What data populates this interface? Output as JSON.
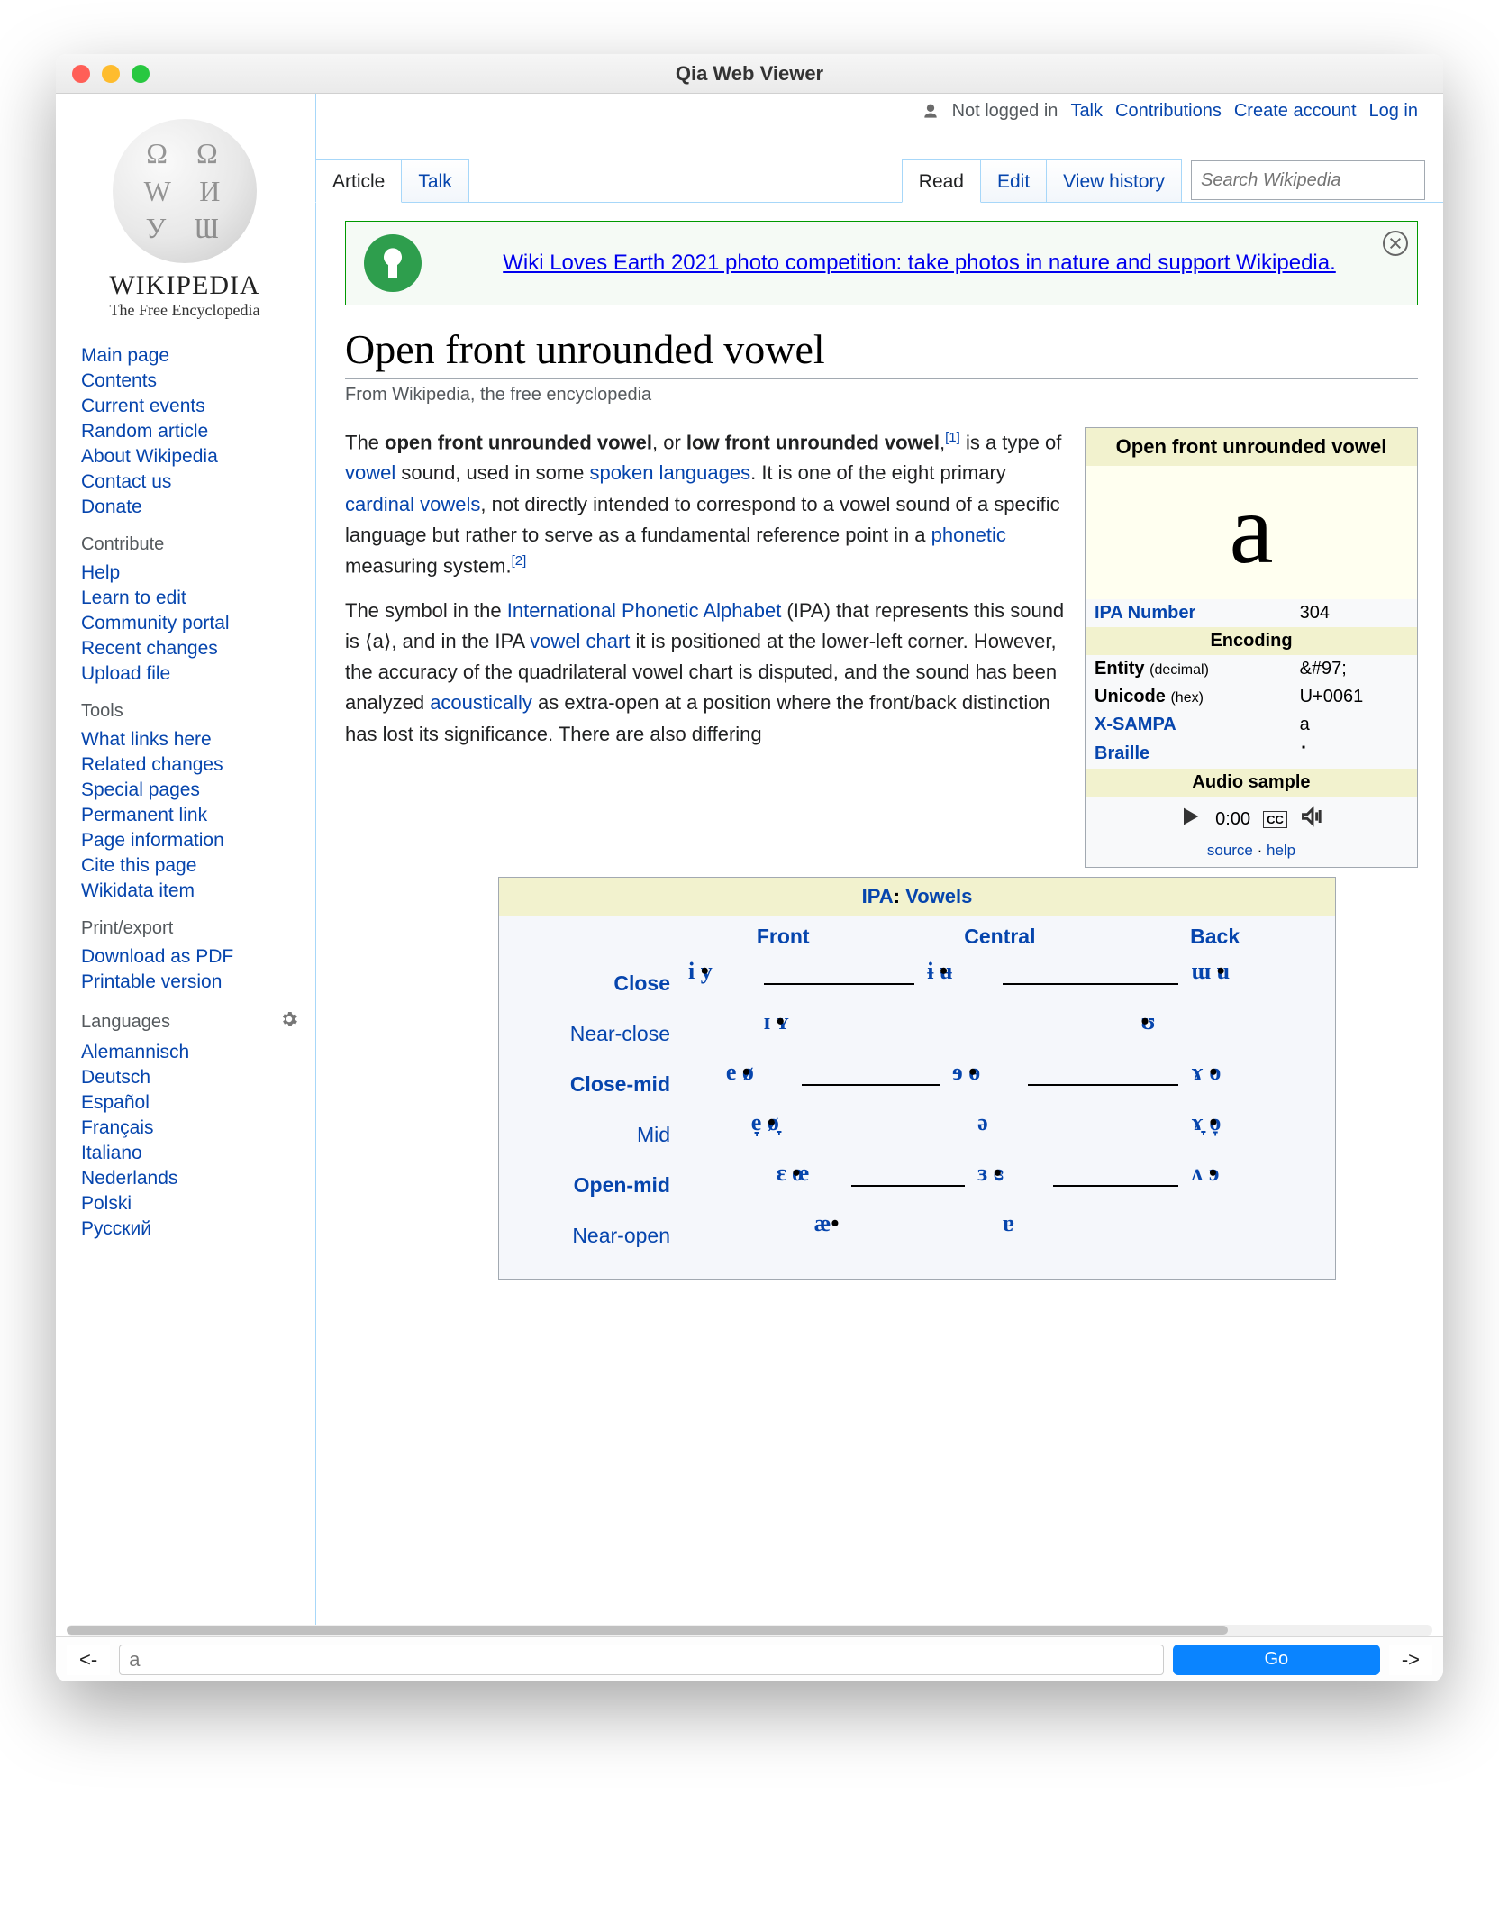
{
  "window": {
    "title": "Qia Web Viewer"
  },
  "personal": {
    "not_logged_in": "Not logged in",
    "talk": "Talk",
    "contributions": "Contributions",
    "create_account": "Create account",
    "log_in": "Log in"
  },
  "tabs": {
    "article": "Article",
    "talk": "Talk",
    "read": "Read",
    "edit": "Edit",
    "history": "View history"
  },
  "search": {
    "placeholder": "Search Wikipedia"
  },
  "logo": {
    "wordmark": "WIKIPEDIA",
    "tagline": "The Free Encyclopedia"
  },
  "sidebar": {
    "main": [
      "Main page",
      "Contents",
      "Current events",
      "Random article",
      "About Wikipedia",
      "Contact us",
      "Donate"
    ],
    "contribute_h": "Contribute",
    "contribute": [
      "Help",
      "Learn to edit",
      "Community portal",
      "Recent changes",
      "Upload file"
    ],
    "tools_h": "Tools",
    "tools": [
      "What links here",
      "Related changes",
      "Special pages",
      "Permanent link",
      "Page information",
      "Cite this page",
      "Wikidata item"
    ],
    "print_h": "Print/export",
    "print": [
      "Download as PDF",
      "Printable version"
    ],
    "lang_h": "Languages",
    "lang": [
      "Alemannisch",
      "Deutsch",
      "Español",
      "Français",
      "Italiano",
      "Nederlands",
      "Polski",
      "Русский"
    ]
  },
  "banner": {
    "text": "Wiki Loves Earth 2021 photo competition: take photos in nature and support Wikipedia."
  },
  "article": {
    "title": "Open front unrounded vowel",
    "siteSub": "From Wikipedia, the free encyclopedia",
    "p1_a": "The ",
    "p1_b": "open front unrounded vowel",
    "p1_c": ", or ",
    "p1_d": "low front unrounded vowel",
    "p1_e": ",",
    "p1_ref1": "[1]",
    "p1_f": " is a type of ",
    "p1_vowel": "vowel",
    "p1_g": " sound, used in some ",
    "p1_spoken": "spoken languages",
    "p1_h": ". It is one of the eight primary ",
    "p1_cardinal": "cardinal vowels",
    "p1_i": ", not directly intended to correspond to a vowel sound of a specific language but rather to serve as a fundamental reference point in a ",
    "p1_phonetic": "phonetic",
    "p1_j": " measuring system.",
    "p1_ref2": "[2]",
    "p2_a": "The symbol in the ",
    "p2_ipa": "International Phonetic Alphabet",
    "p2_b": " (IPA) that represents this sound is ⟨a⟩, and in the IPA ",
    "p2_vchart": "vowel chart",
    "p2_c": " it is positioned at the lower-left corner. However, the accuracy of the quadrilateral vowel chart is disputed, and the sound has been analyzed ",
    "p2_acoust": "acoustically",
    "p2_d": " as extra-open at a position where the front/back distinction has lost its significance. There are also differing"
  },
  "infobox": {
    "title": "Open front unrounded vowel",
    "symbol": "a",
    "ipa_num_l": "IPA Number",
    "ipa_num": "304",
    "encoding_h": "Encoding",
    "entity_l": "Entity",
    "entity_small": "(decimal)",
    "entity_v": "&#97;",
    "unicode_l": "Unicode",
    "unicode_small": "(hex)",
    "unicode_v": "U+0061",
    "xsampa_l": "X-SAMPA",
    "xsampa_v": "a",
    "braille_l": "Braille",
    "audio_h": "Audio sample",
    "audio_time": "0:00",
    "audio_cc": "CC",
    "src": "source",
    "help": "help"
  },
  "vowelchart": {
    "head_ipa": "IPA",
    "head_sep": ": ",
    "head_vowels": "Vowels",
    "cols": {
      "front": "Front",
      "central": "Central",
      "back": "Back"
    },
    "rows": {
      "close": "Close",
      "near_close": "Near-close",
      "close_mid": "Close-mid",
      "mid": "Mid",
      "open_mid": "Open-mid",
      "near_open": "Near-open"
    }
  },
  "addressbar": {
    "back": "<-",
    "forward": "->",
    "value": "a",
    "go": "Go"
  }
}
